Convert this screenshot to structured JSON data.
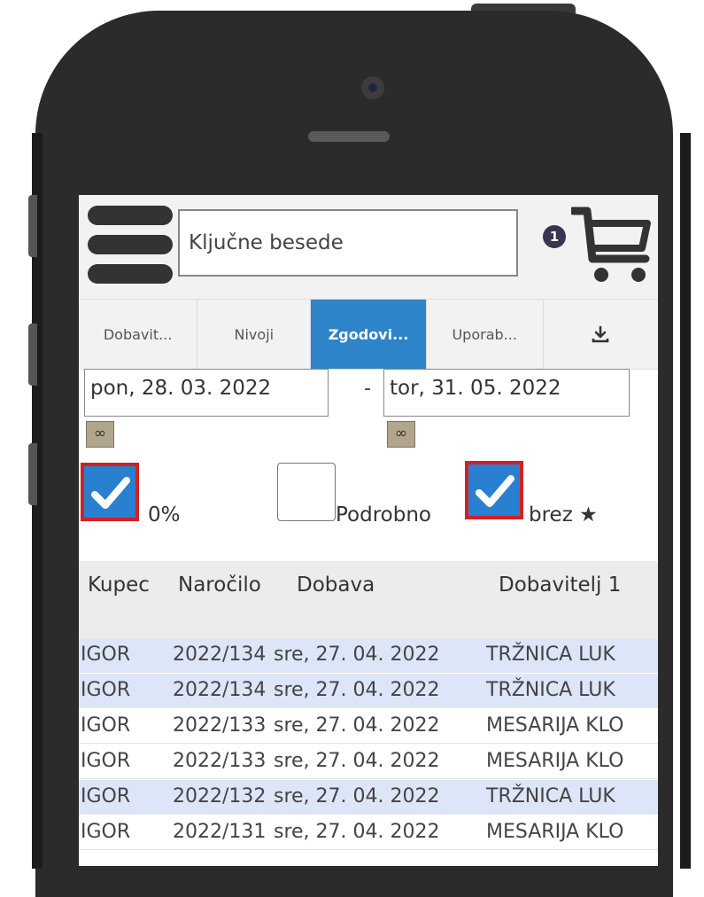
{
  "search": {
    "placeholder": "Ključne besede"
  },
  "cart": {
    "badge_count": "1"
  },
  "tabs": [
    {
      "label": "Dobavit...",
      "active": false
    },
    {
      "label": "Nivoji",
      "active": false
    },
    {
      "label": "Zgodovi...",
      "active": true
    },
    {
      "label": "Uporab...",
      "active": false
    }
  ],
  "download_icon": "download-icon",
  "date_from": "pon, 28. 03. 2022",
  "date_separator": "-",
  "date_to": "tor, 31. 05. 2022",
  "infinity_label": "∞",
  "filters": [
    {
      "label": "0%",
      "checked": true
    },
    {
      "label": "Podrobno",
      "checked": false
    },
    {
      "label": "brez ★",
      "checked": true
    }
  ],
  "table": {
    "headers": [
      "Kupec",
      "Naročilo",
      "Dobava",
      "Dobavitelj 1"
    ],
    "rows": [
      {
        "kupec": "IGOR",
        "narocilo": "2022/134",
        "dobava": "sre, 27. 04. 2022",
        "dobavitelj": "TRŽNICA LUK",
        "highlight": true
      },
      {
        "kupec": "IGOR",
        "narocilo": "2022/134",
        "dobava": "sre, 27. 04. 2022",
        "dobavitelj": "TRŽNICA LUK",
        "highlight": true
      },
      {
        "kupec": "IGOR",
        "narocilo": "2022/133",
        "dobava": "sre, 27. 04. 2022",
        "dobavitelj": "MESARIJA KLO",
        "highlight": false
      },
      {
        "kupec": "IGOR",
        "narocilo": "2022/133",
        "dobava": "sre, 27. 04. 2022",
        "dobavitelj": "MESARIJA KLO",
        "highlight": false
      },
      {
        "kupec": "IGOR",
        "narocilo": "2022/132",
        "dobava": "sre, 27. 04. 2022",
        "dobavitelj": "TRŽNICA LUK",
        "highlight": true
      },
      {
        "kupec": "IGOR",
        "narocilo": "2022/131",
        "dobava": "sre, 27. 04. 2022",
        "dobavitelj": "MESARIJA KLO",
        "highlight": false
      }
    ]
  },
  "colors": {
    "accent": "#2d84c8",
    "checkbox_border": "#d42020",
    "row_highlight": "#dde6f8"
  }
}
